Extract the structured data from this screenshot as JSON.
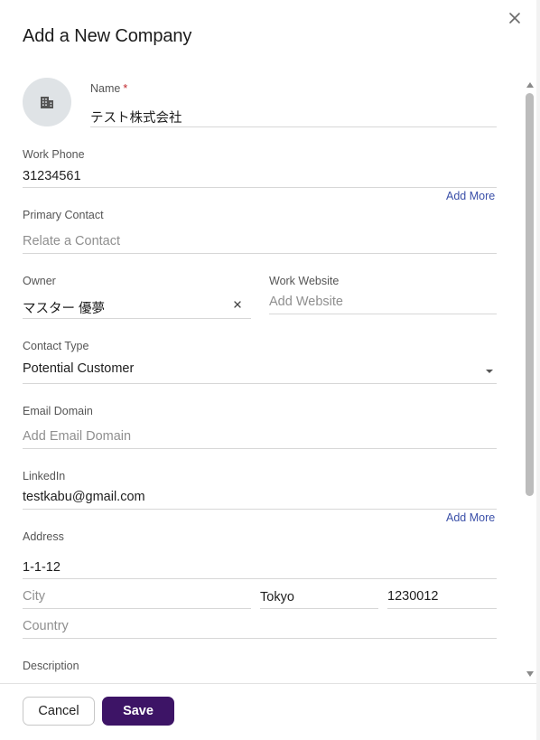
{
  "dialog": {
    "title": "Add a New Company",
    "close_icon": "close-icon"
  },
  "form": {
    "avatar_icon": "building-icon",
    "name": {
      "label": "Name",
      "required_mark": "*",
      "value": "テスト株式会社"
    },
    "work_phone": {
      "label": "Work Phone",
      "value": "31234561",
      "add_more": "Add More"
    },
    "primary_contact": {
      "label": "Primary Contact",
      "placeholder": "Relate a Contact"
    },
    "owner": {
      "label": "Owner",
      "value": "マスター 優夢",
      "clear_icon": "clear-icon"
    },
    "work_website": {
      "label": "Work Website",
      "placeholder": "Add Website"
    },
    "contact_type": {
      "label": "Contact Type",
      "value": "Potential Customer",
      "dropdown_icon": "caret-down-icon"
    },
    "email_domain": {
      "label": "Email Domain",
      "placeholder": "Add Email Domain"
    },
    "linkedin": {
      "label": "LinkedIn",
      "value": "testkabu@gmail.com",
      "add_more": "Add More"
    },
    "address": {
      "label": "Address",
      "street": "1-1-12",
      "city_placeholder": "City",
      "state": "Tokyo",
      "zip": "1230012",
      "country_placeholder": "Country"
    },
    "description": {
      "label": "Description"
    }
  },
  "footer": {
    "cancel_label": "Cancel",
    "save_label": "Save"
  },
  "colors": {
    "save_button": "#3d1466",
    "link": "#3a4fa8",
    "required": "#c0262c"
  }
}
